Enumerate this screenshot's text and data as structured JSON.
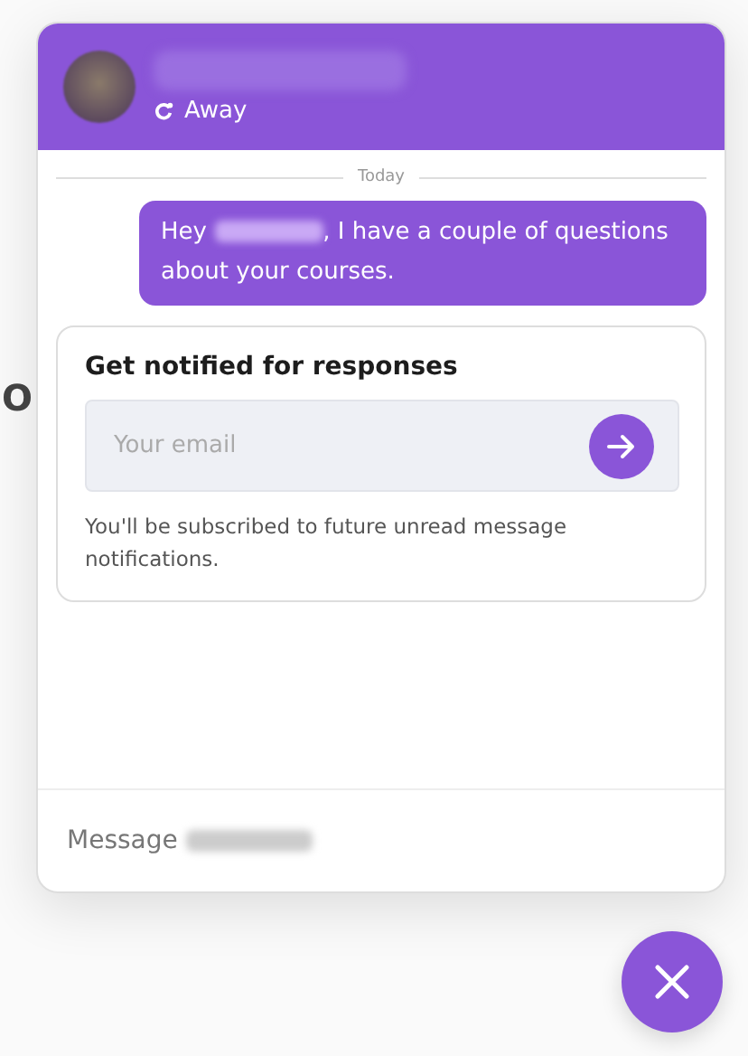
{
  "background_text": "O",
  "header": {
    "status": "Away"
  },
  "divider": {
    "label": "Today"
  },
  "messages": [
    {
      "before": "Hey",
      "after": ", I have a couple of questions about your courses."
    }
  ],
  "notify_card": {
    "title": "Get notified for responses",
    "email": {
      "placeholder": "Your email"
    },
    "note": "You'll be subscribed to future unread message notifications."
  },
  "composer": {
    "placeholder": "Message"
  }
}
